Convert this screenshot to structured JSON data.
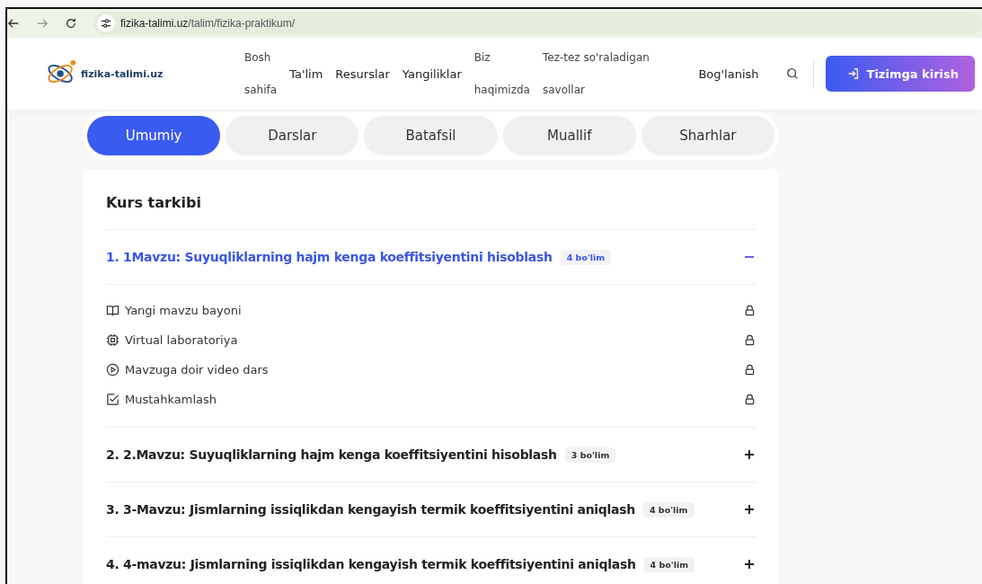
{
  "browser": {
    "url_host": "fizika-talimi.uz",
    "url_path": "/talim/fizika-praktikum/"
  },
  "header": {
    "logo": "fizika-talimi.uz",
    "nav": [
      {
        "lines": [
          "Bosh",
          "sahifa"
        ]
      },
      {
        "lines": [
          "Ta'lim"
        ]
      },
      {
        "lines": [
          "Resurslar"
        ]
      },
      {
        "lines": [
          "Yangiliklar"
        ]
      },
      {
        "lines": [
          "Biz",
          "haqimizda"
        ]
      },
      {
        "lines": [
          "Tez-tez so'raladigan",
          "savollar"
        ]
      },
      {
        "lines": [
          "Bog'lanish"
        ]
      }
    ],
    "login": "Tizimga kirish"
  },
  "tabs": [
    {
      "label": "Umumiy",
      "selected": true
    },
    {
      "label": "Darslar",
      "selected": false
    },
    {
      "label": "Batafsil",
      "selected": false
    },
    {
      "label": "Muallif",
      "selected": false
    },
    {
      "label": "Sharhlar",
      "selected": false
    }
  ],
  "course": {
    "title": "Kurs tarkibi",
    "modules": [
      {
        "title": "1. 1Mavzu: Suyuqliklarning hajm kenga koeffitsiyentini hisoblash",
        "badge": "4 bo'lim",
        "expanded": true,
        "lessons": [
          {
            "kind": "book",
            "label": "Yangi mavzu bayoni",
            "locked": true
          },
          {
            "kind": "chip",
            "label": "Virtual laboratoriya",
            "locked": true
          },
          {
            "kind": "video",
            "label": "Mavzuga doir video dars",
            "locked": true
          },
          {
            "kind": "check",
            "label": "Mustahkamlash",
            "locked": true
          }
        ]
      },
      {
        "title": "2. 2.Mavzu: Suyuqliklarning hajm kenga koeffitsiyentini hisoblash",
        "badge": "3 bo'lim",
        "expanded": false
      },
      {
        "title": "3. 3-Mavzu: Jismlarning issiqlikdan kengayish termik koeffitsiyentini aniqlash",
        "badge": "4 bo'lim",
        "expanded": false
      },
      {
        "title": "4. 4-mavzu: Jismlarning issiqlikdan kengayish termik koeffitsiyentini aniqlash",
        "badge": "4 bo'lim",
        "expanded": false
      }
    ]
  }
}
